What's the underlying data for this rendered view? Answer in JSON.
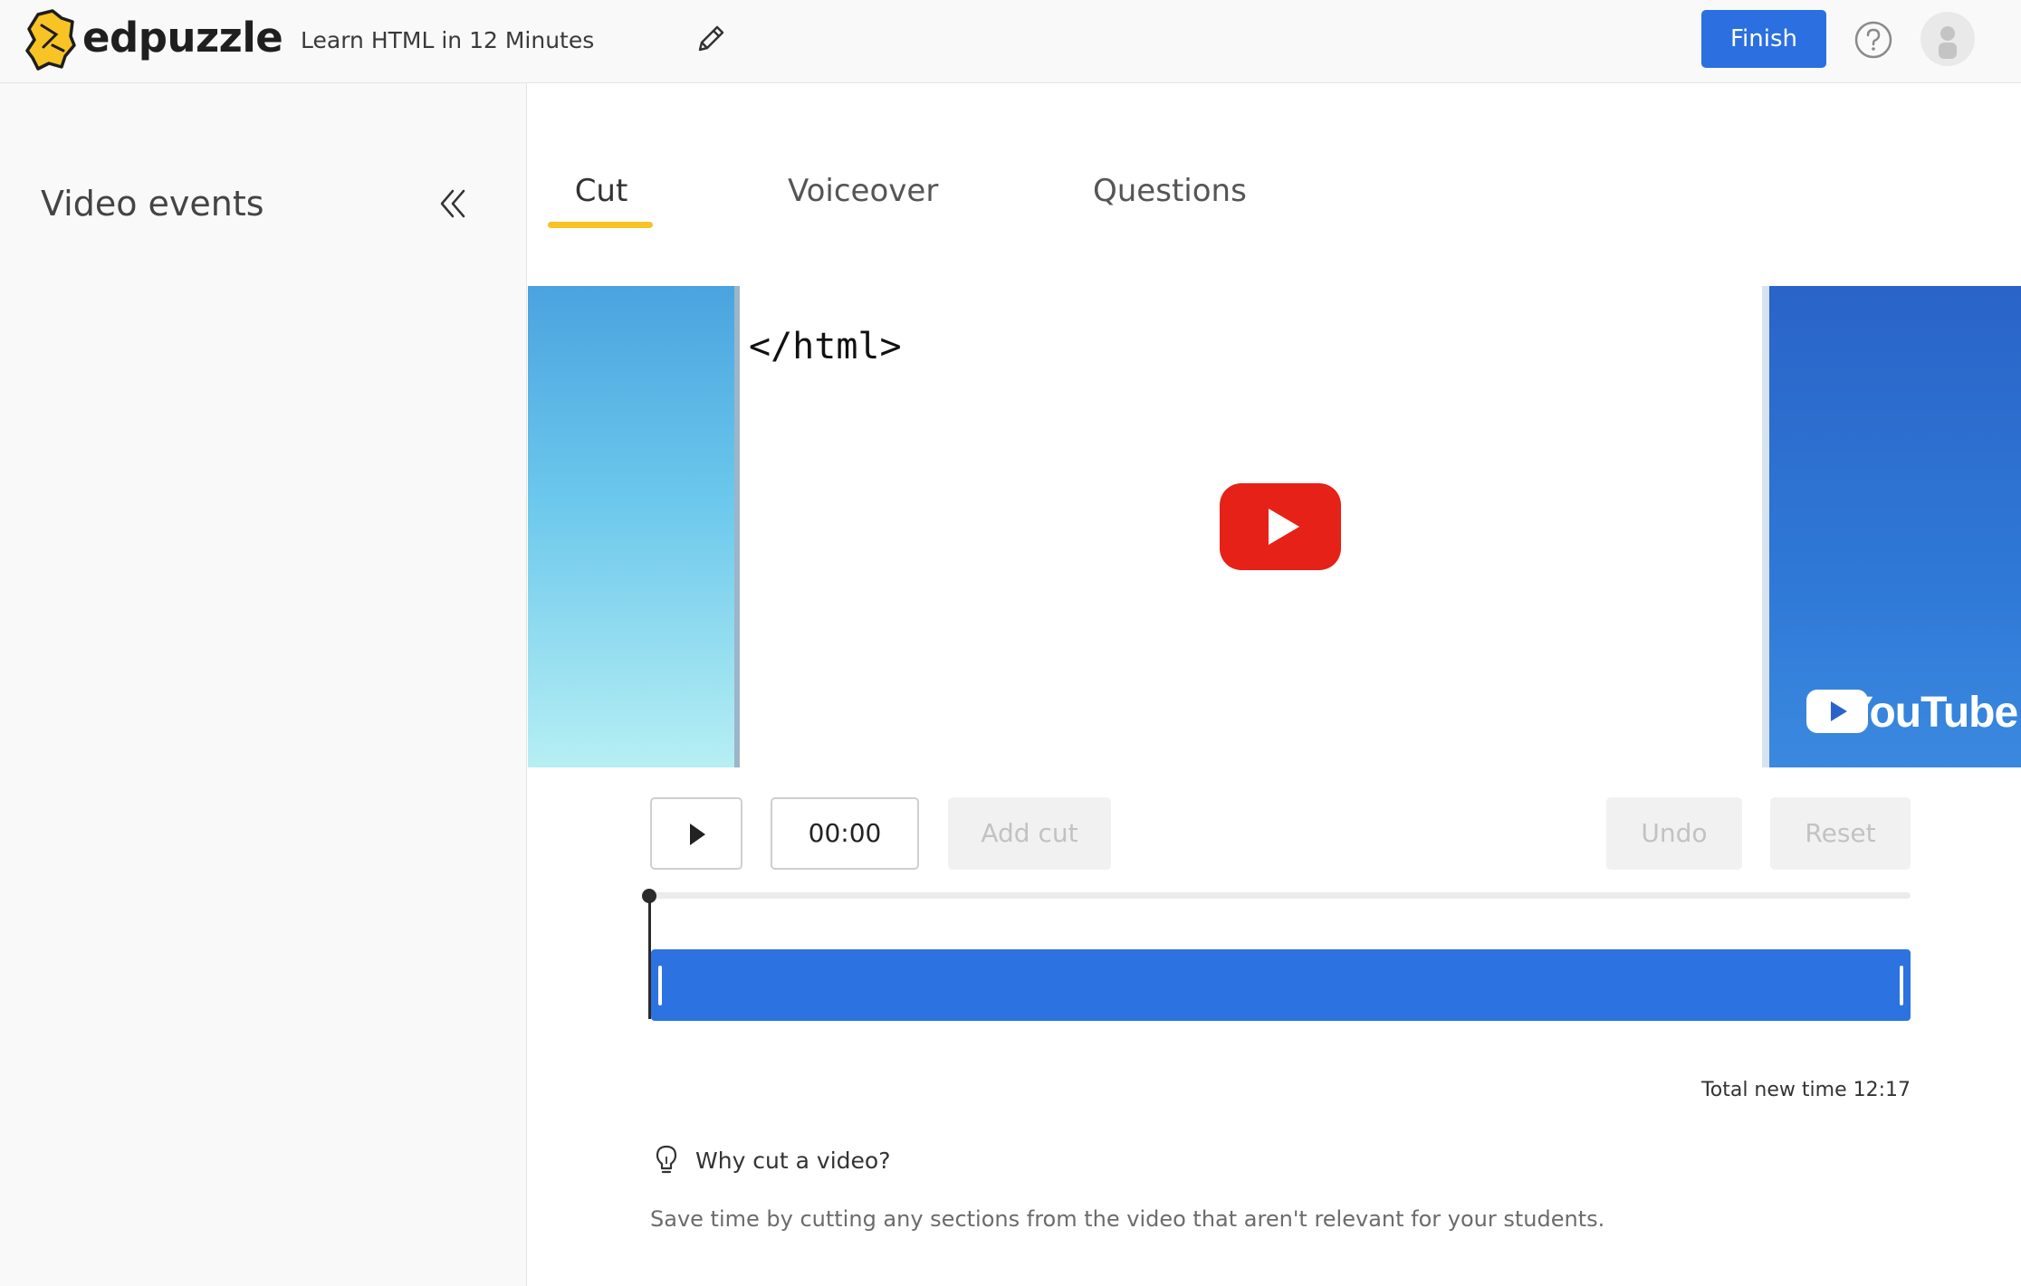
{
  "app": {
    "brand": "edpuzzle",
    "document_title": "Learn HTML in 12 Minutes",
    "finish_label": "Finish"
  },
  "sidebar": {
    "title": "Video events"
  },
  "tabs": [
    {
      "label": "Cut",
      "active": true
    },
    {
      "label": "Voiceover",
      "active": false
    },
    {
      "label": "Questions",
      "active": false
    }
  ],
  "video": {
    "frame_text": "</html>",
    "watermark": "YouTube"
  },
  "controls": {
    "current_time": "00:00",
    "add_cut_label": "Add cut",
    "undo_label": "Undo",
    "reset_label": "Reset"
  },
  "timeline": {
    "total_new_time": "Total new time 12:17"
  },
  "tip": {
    "title": "Why cut a video?",
    "text": "Save time by cutting any sections from the video that aren't relevant for your students."
  },
  "colors": {
    "accent_blue": "#2c6fe0",
    "tab_underline": "#f7c325",
    "youtube_red": "#e62117",
    "logo_yellow": "#f7c325"
  },
  "icons": [
    "edpuzzle-logo-icon",
    "pencil-icon",
    "help-icon",
    "avatar-icon",
    "double-chevron-left-icon",
    "youtube-play-icon",
    "play-icon",
    "lightbulb-icon"
  ]
}
